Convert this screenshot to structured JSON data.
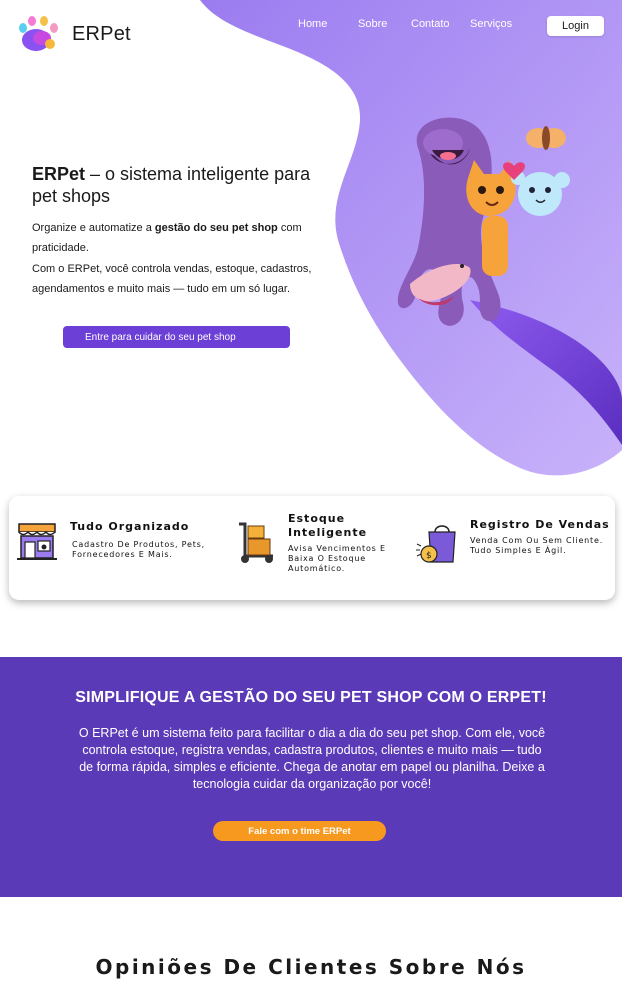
{
  "brand": {
    "name": "ERPet"
  },
  "nav": {
    "home": "Home",
    "sobre": "Sobre",
    "contato": "Contato",
    "servicos": "Serviços",
    "login": "Login"
  },
  "hero": {
    "title_bold": "ERPet",
    "title_rest": " – o sistema inteligente para pet shops",
    "p1_before": "Organize e automatize a ",
    "p1_bold": "gestão do seu pet shop",
    "p1_after": " com praticidade.",
    "p2": "Com o ERPet, você controla vendas, estoque, cadastros, agendamentos e muito mais — tudo em um só lugar.",
    "cta": "Entre para cuidar do seu pet shop"
  },
  "features": [
    {
      "title": "Tudo Organizado",
      "desc": "Cadastro De Produtos, Pets, Fornecedores E Mais.",
      "icon": "storefront-icon"
    },
    {
      "title": "Estoque Inteligente",
      "desc": "Avisa Vencimentos E Baixa O Estoque Automático.",
      "icon": "hand-truck-boxes-icon"
    },
    {
      "title": "Registro De Vendas",
      "desc": "Venda Com Ou Sem Cliente. Tudo Simples E Ágil.",
      "icon": "shopping-bag-coins-icon"
    }
  ],
  "band": {
    "title": "SIMPLIFIQUE A GESTÃO DO SEU PET SHOP COM O ERPET!",
    "text": "O ERPet é um sistema feito para facilitar o dia a dia do seu pet shop. Com ele, você controla estoque, registra vendas, cadastra produtos, clientes e muito mais — tudo de forma rápida, simples e eficiente. Chega de anotar em papel ou planilha. Deixe a tecnologia cuidar da organização por você!",
    "cta": "Fale com o time ERPet"
  },
  "opinioes": {
    "title": "Opiniões De Clientes Sobre Nós"
  },
  "colors": {
    "purple": "#6c3fd6",
    "lavender": "#b9a0f7",
    "band": "#5b3ab8",
    "orange": "#f7981f"
  }
}
